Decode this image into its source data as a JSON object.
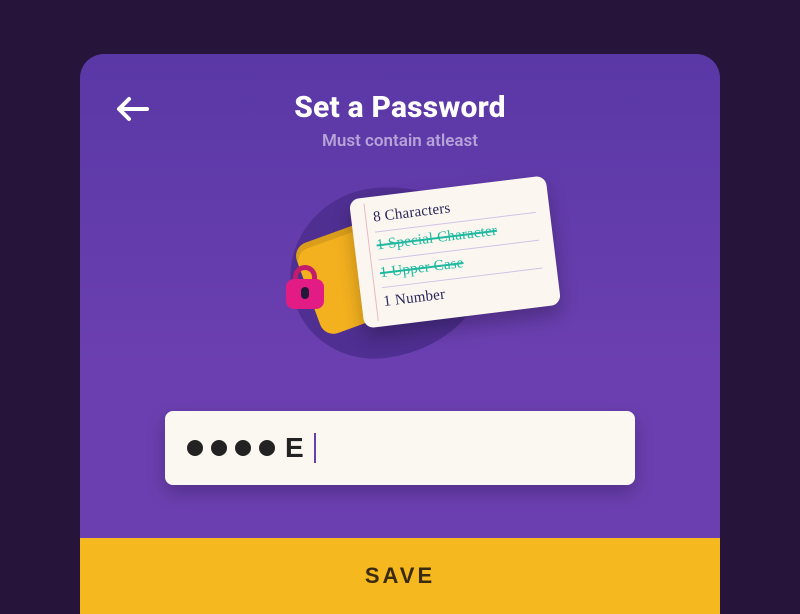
{
  "header": {
    "title": "Set a Password",
    "subtitle": "Must contain atleast"
  },
  "requirements": [
    {
      "label": "8 Characters",
      "met": false
    },
    {
      "label": "1 Special Character",
      "met": true
    },
    {
      "label": "1 Upper Case",
      "met": true
    },
    {
      "label": "1 Number",
      "met": false
    }
  ],
  "password": {
    "masked_dots": 4,
    "visible_suffix": "E"
  },
  "actions": {
    "save_label": "SAVE"
  },
  "colors": {
    "page_bg": "#27143a",
    "card_bg": "#6b3fb0",
    "accent_yellow": "#f6b81f",
    "accent_pink": "#e31b84",
    "done_green": "#1fb9a0"
  }
}
